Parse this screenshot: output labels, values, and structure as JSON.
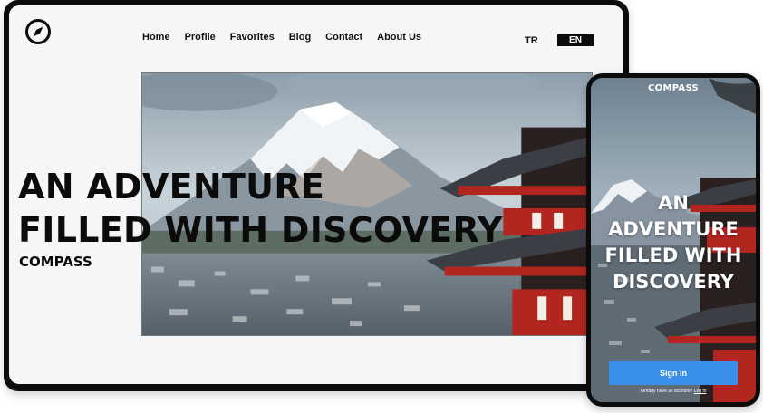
{
  "desktop": {
    "nav": {
      "items": [
        "Home",
        "Profile",
        "Favorites",
        "Blog",
        "Contact",
        "About Us"
      ]
    },
    "lang": {
      "tr": "TR",
      "en": "EN",
      "active": "EN"
    },
    "hero": {
      "headline_line1": "AN ADVENTURE",
      "headline_line2": "FILLED WITH DISCOVERY",
      "brand": "COMPASS"
    },
    "logo_icon": "compass-icon"
  },
  "phone": {
    "brand": "COMPASS",
    "headline_line1": "AN",
    "headline_line2": "ADVENTURE",
    "headline_line3": "FILLED WITH",
    "headline_line4": "DISCOVERY",
    "signin_label": "Sign in",
    "login_prompt": "Already have an account?",
    "login_link": "Log in"
  },
  "colors": {
    "device_frame": "#0c0c0c",
    "desktop_bg": "#f4f6f8",
    "accent_button": "#3a8fea",
    "pagoda_red": "#b2261f"
  }
}
